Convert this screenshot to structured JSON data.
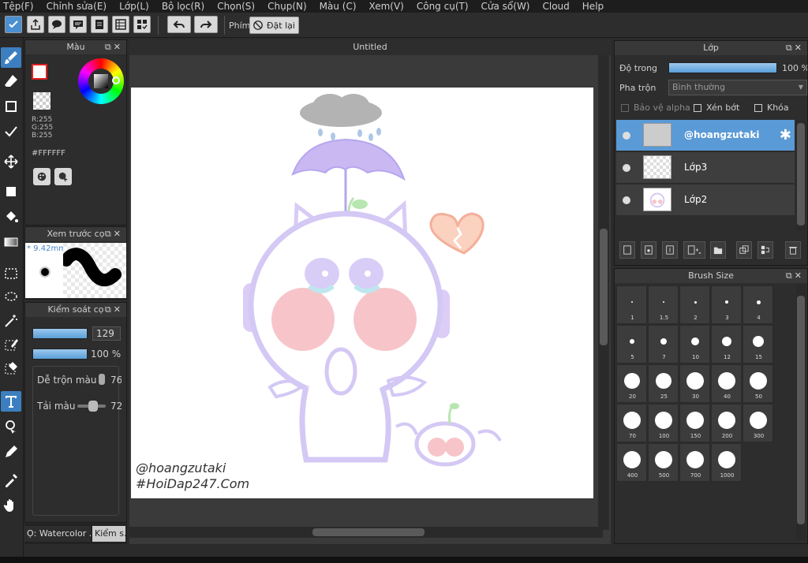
{
  "menu": [
    "Tệp(F)",
    "Chỉnh sửa(E)",
    "Lớp(L)",
    "Bộ lọc(R)",
    "Chọn(S)",
    "Chụp(N)",
    "Màu (C)",
    "Xem(V)",
    "Công cụ(T)",
    "Cửa sổ(W)",
    "Cloud",
    "Help"
  ],
  "toolbar": {
    "shortcut_label": "Phím",
    "reset_label": "Đặt lại"
  },
  "color_panel": {
    "title": "Màu",
    "r": "R:255",
    "g": "G:255",
    "b": "B:255",
    "hex": "#FFFFFF",
    "primary_color": "#ffffff",
    "secondary_color": "#ffffff",
    "accent": "#e02020"
  },
  "preview_panel": {
    "title": "Xem trước cọ",
    "size": "* 9.42mm"
  },
  "brush_control": {
    "title": "Kiểm soát cọ",
    "size_value": "129",
    "opacity_value": "100 %",
    "blend_label": "Dễ trộn màu",
    "blend_value": "76",
    "paint_label": "Tải màu",
    "paint_value": "72"
  },
  "brush_tabs": {
    "tab1": "Ọ: Watercolor .",
    "tab2": "Kiểm s."
  },
  "document": {
    "tab_title": "Untitled",
    "watermark_line1": "@hoangzutaki",
    "watermark_line2": "#HoiDap247.Com"
  },
  "layer_panel": {
    "title": "Lớp",
    "opacity_label": "Độ trong",
    "opacity_value": "100 %",
    "blend_label": "Pha trộn",
    "blend_value": "Bình thường",
    "protect_alpha": "Bảo vệ alpha",
    "clip": "Xén bớt",
    "lock": "Khóa",
    "layers": [
      {
        "name": "@hoangzutaki",
        "selected": true
      },
      {
        "name": "Lớp3",
        "selected": false
      },
      {
        "name": "Lớp2",
        "selected": false
      }
    ]
  },
  "brush_size_panel": {
    "title": "Brush Size",
    "sizes": [
      "1",
      "1.5",
      "2",
      "3",
      "4",
      "5",
      "7",
      "10",
      "12",
      "15",
      "20",
      "25",
      "30",
      "40",
      "50",
      "70",
      "100",
      "150",
      "200",
      "300",
      "400",
      "500",
      "700",
      "1000"
    ]
  },
  "colors": {
    "accent": "#5a9ad6",
    "panel": "#2d2d2d",
    "selection": "#3c7fc0"
  }
}
